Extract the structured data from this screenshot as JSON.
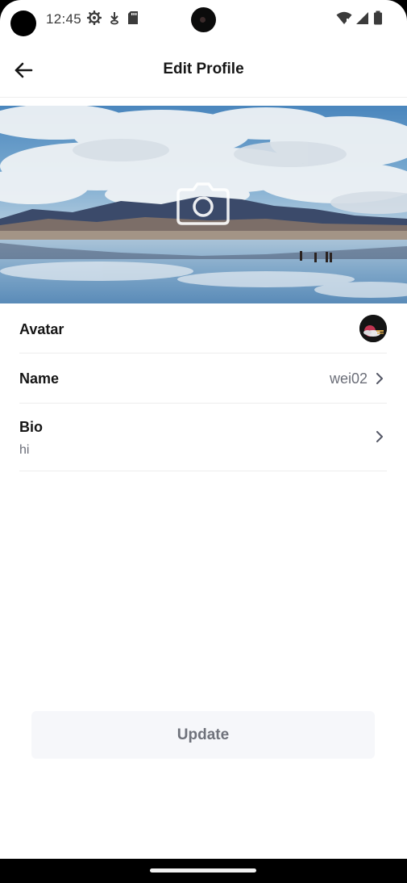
{
  "status_bar": {
    "time": "12:45",
    "icons_left": [
      "settings-gear-icon",
      "download-arrow-icon",
      "sd-card-icon"
    ],
    "icons_right": [
      "wifi-icon",
      "cell-signal-icon",
      "battery-icon"
    ]
  },
  "header": {
    "title": "Edit Profile",
    "back_icon": "arrow-left-icon"
  },
  "cover": {
    "overlay_icon": "camera-icon"
  },
  "profile": {
    "avatar_label": "Avatar",
    "name_label": "Name",
    "name_value": "wei02",
    "bio_label": "Bio",
    "bio_value": "hi"
  },
  "actions": {
    "update_label": "Update"
  },
  "colors": {
    "text_primary": "#161616",
    "text_secondary": "#6b6e78",
    "divider": "#ededed",
    "button_bg": "#f6f7fa",
    "button_text": "#6f727b"
  }
}
